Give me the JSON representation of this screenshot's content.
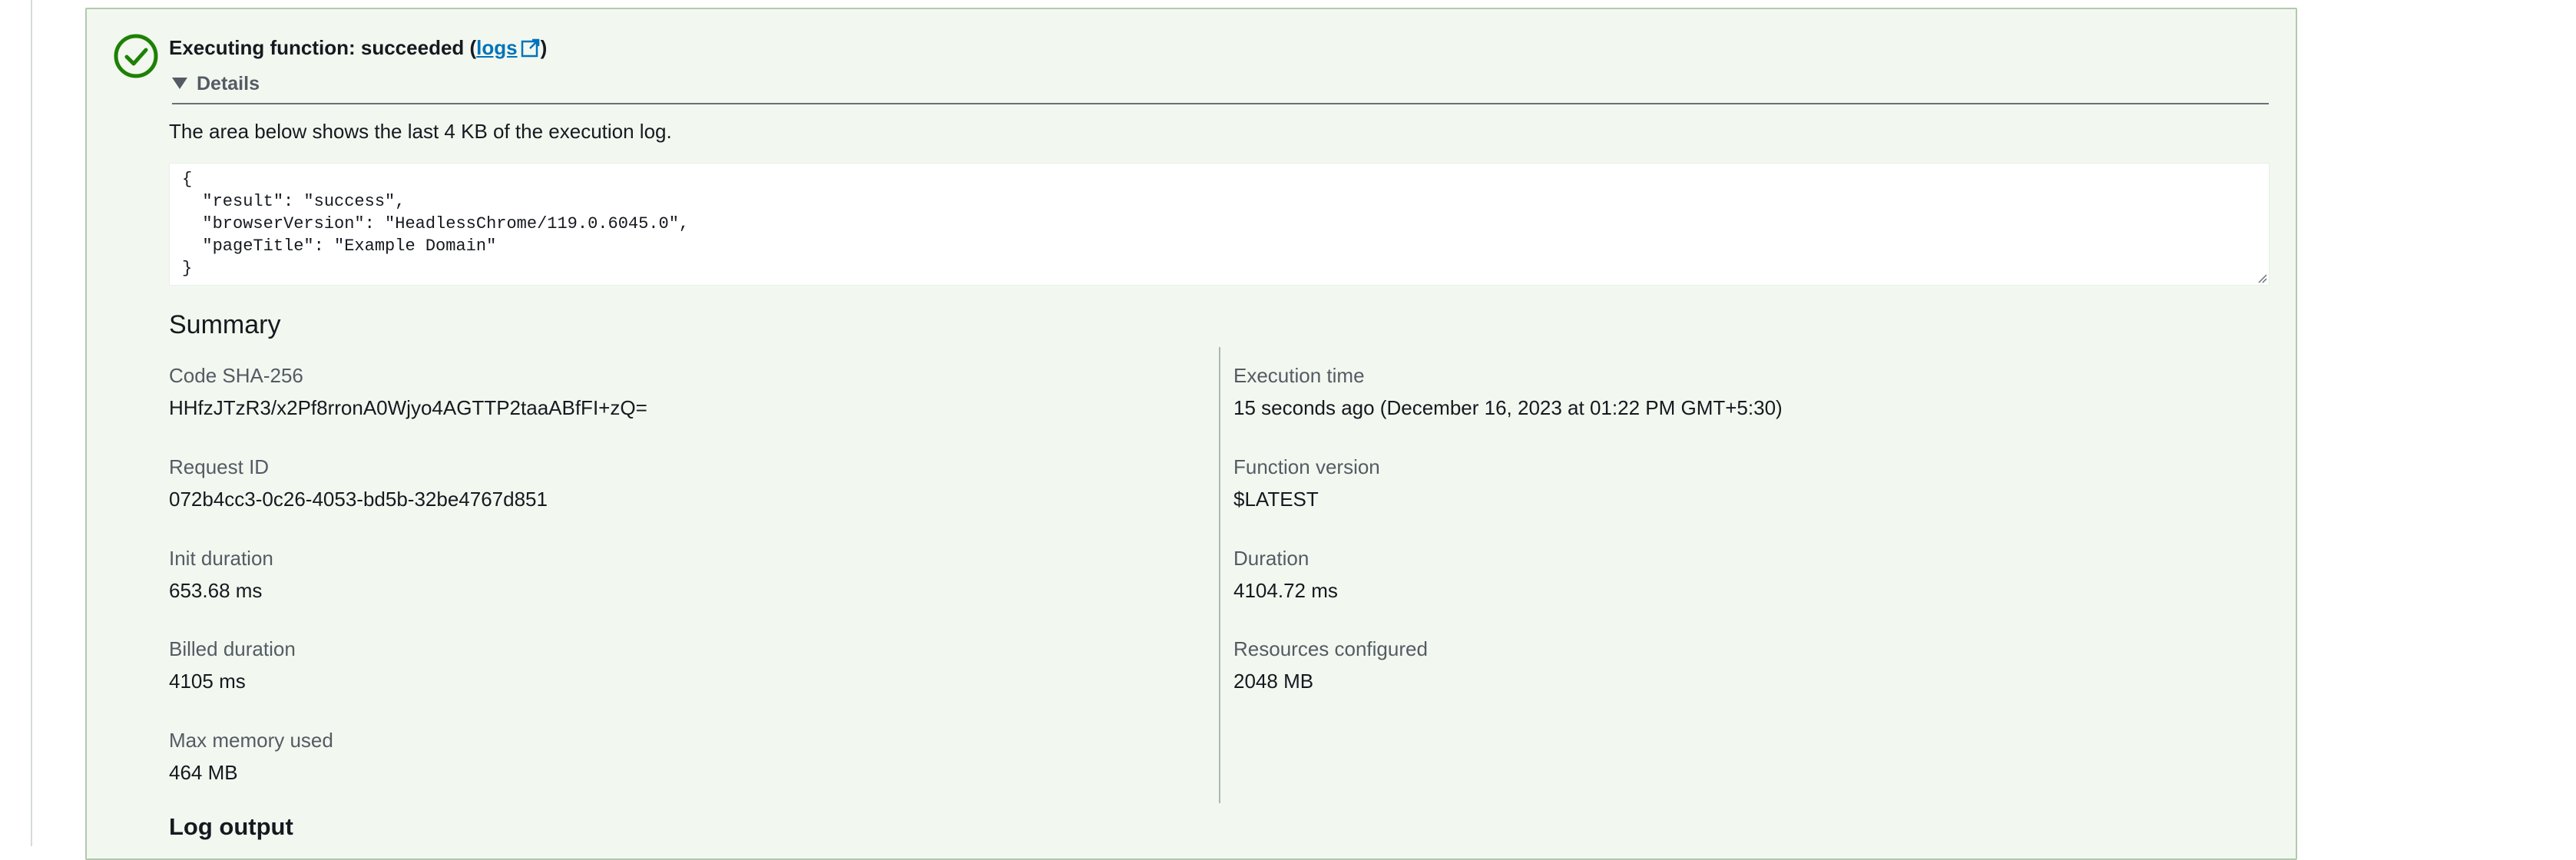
{
  "status": {
    "prefix": "Executing function: succeeded (",
    "logs_link": "logs",
    "suffix": ")",
    "icon": "check-circle-icon",
    "color": "#1d8102"
  },
  "details": {
    "label": "Details",
    "description": "The area below shows the last 4 KB of the execution log.",
    "log_text": "{\n  \"result\": \"success\",\n  \"browserVersion\": \"HeadlessChrome/119.0.6045.0\",\n  \"pageTitle\": \"Example Domain\"\n}"
  },
  "summary": {
    "title": "Summary",
    "left": [
      {
        "label": "Code SHA-256",
        "value": "HHfzJTzR3/x2Pf8rronA0Wjyo4AGTTP2taaABfFI+zQ="
      },
      {
        "label": "Request ID",
        "value": "072b4cc3-0c26-4053-bd5b-32be4767d851"
      },
      {
        "label": "Init duration",
        "value": "653.68 ms"
      },
      {
        "label": "Billed duration",
        "value": "4105 ms"
      },
      {
        "label": "Max memory used",
        "value": "464 MB"
      }
    ],
    "right": [
      {
        "label": "Execution time",
        "value": "15 seconds ago (December 16, 2023 at 01:22 PM GMT+5:30)"
      },
      {
        "label": "Function version",
        "value": "$LATEST"
      },
      {
        "label": "Duration",
        "value": "4104.72 ms"
      },
      {
        "label": "Resources configured",
        "value": "2048 MB"
      }
    ]
  },
  "log_output": {
    "title": "Log output"
  }
}
